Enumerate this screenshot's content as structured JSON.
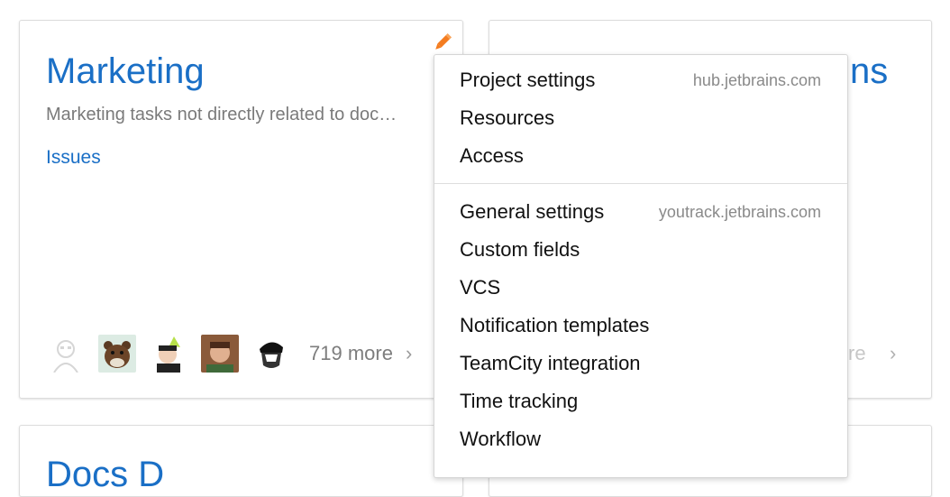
{
  "cards": {
    "marketing": {
      "title": "Marketing",
      "description": "Marketing tasks not directly related to doc…",
      "issues_link": "Issues",
      "more_members": "719 more",
      "chevron": "›",
      "avatars": [
        "avatar-icon-default",
        "avatar-bear",
        "avatar-party-kid",
        "avatar-man",
        "avatar-portrait"
      ]
    },
    "right": {
      "title_fragment": "ns",
      "more_fragment": "re",
      "chevron": "›"
    },
    "bottom_left": {
      "title_fragment": "Docs D"
    }
  },
  "dropdown": {
    "group1": {
      "host": "hub.jetbrains.com",
      "items": [
        "Project settings",
        "Resources",
        "Access"
      ]
    },
    "group2": {
      "host": "youtrack.jetbrains.com",
      "items": [
        "General settings",
        "Custom fields",
        "VCS",
        "Notification templates",
        "TeamCity integration",
        "Time tracking",
        "Workflow"
      ]
    }
  },
  "colors": {
    "link": "#1a6fc6",
    "edit_icon": "#f47c20",
    "muted_text": "#7a7a7a"
  }
}
